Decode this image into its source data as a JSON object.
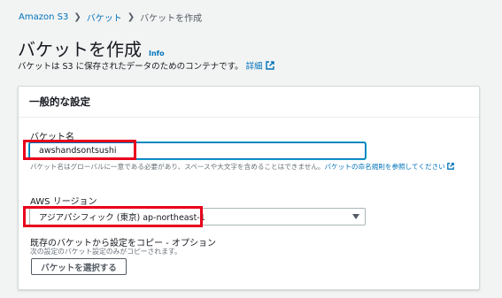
{
  "breadcrumb": {
    "items": [
      "Amazon S3",
      "バケット"
    ],
    "current": "バケットを作成"
  },
  "header": {
    "title": "バケットを作成",
    "info": "Info",
    "description": "バケットは S3 に保存されたデータのためのコンテナです。",
    "details_link": "詳細"
  },
  "panel": {
    "title": "一般的な設定",
    "bucket_name": {
      "label": "バケット名",
      "value": "awshandsontsushi",
      "hint": "バケット名はグローバルに一意である必要があり、スペースや大文字を含めることはできません。",
      "hint_link": "バケットの命名規則を参照してください"
    },
    "region": {
      "label": "AWS リージョン",
      "selected": "アジアパシフィック (東京) ap-northeast-1"
    },
    "copy": {
      "label": "既存のバケットから設定をコピー - オプション",
      "sublabel": "次の設定のバケット設定のみがコピーされます。",
      "button": "バケットを選択する"
    }
  },
  "colors": {
    "accent": "#0073bb",
    "highlight": "#e8001c"
  }
}
